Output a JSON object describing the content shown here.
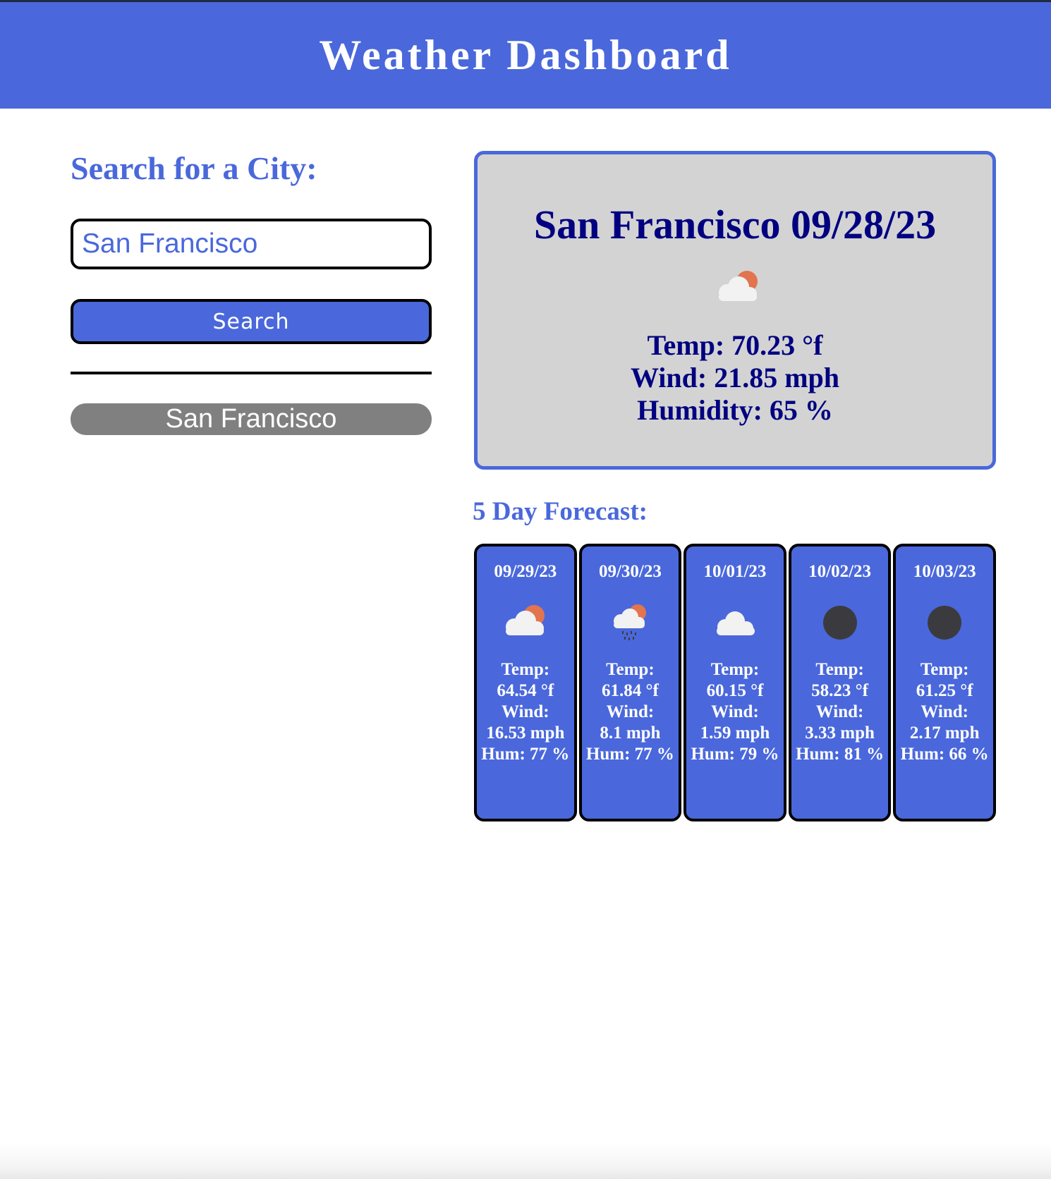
{
  "header": {
    "title": "Weather Dashboard"
  },
  "search": {
    "heading": "Search for a City:",
    "input_value": "San Francisco",
    "button_label": "Search"
  },
  "history": {
    "items": [
      "San Francisco"
    ]
  },
  "current": {
    "title": "San Francisco 09/28/23",
    "icon": "partly-cloudy-day-icon",
    "temp": "Temp: 70.23 °f",
    "wind": "Wind: 21.85 mph",
    "humidity": "Humidity: 65 %"
  },
  "forecast": {
    "heading": "5 Day Forecast:",
    "days": [
      {
        "date": "09/29/23",
        "icon": "partly-cloudy-day-icon",
        "temp_label": "Temp:",
        "temp": "64.54 °f",
        "wind_label": "Wind:",
        "wind": "16.53 mph",
        "hum": "Hum: 77 %"
      },
      {
        "date": "09/30/23",
        "icon": "rain-cloud-icon",
        "temp_label": "Temp:",
        "temp": "61.84 °f",
        "wind_label": "Wind:",
        "wind": "8.1 mph",
        "hum": "Hum: 77 %"
      },
      {
        "date": "10/01/23",
        "icon": "cloud-icon",
        "temp_label": "Temp:",
        "temp": "60.15 °f",
        "wind_label": "Wind:",
        "wind": "1.59 mph",
        "hum": "Hum: 79 %"
      },
      {
        "date": "10/02/23",
        "icon": "clear-night-icon",
        "temp_label": "Temp:",
        "temp": "58.23 °f",
        "wind_label": "Wind:",
        "wind": "3.33 mph",
        "hum": "Hum: 81 %"
      },
      {
        "date": "10/03/23",
        "icon": "clear-night-icon",
        "temp_label": "Temp:",
        "temp": "61.25 °f",
        "wind_label": "Wind:",
        "wind": "2.17 mph",
        "hum": "Hum: 66 %"
      }
    ]
  },
  "colors": {
    "accent": "#4a68db",
    "card_bg": "#d3d3d3",
    "navy_text": "#000080",
    "history_bg": "#808080"
  }
}
